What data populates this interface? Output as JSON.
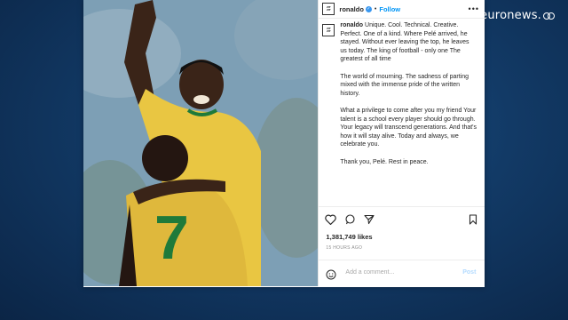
{
  "broadcaster": {
    "logo_text": "euronews."
  },
  "post": {
    "username": "ronaldo",
    "follow_label": "Follow",
    "separator": "•",
    "more_label": "•••",
    "avatar_text": [
      "ZIT",
      "ZIT"
    ],
    "caption_paragraphs": [
      "Unique. Cool. Technical. Creative. Perfect. One of a kind. Where Pelé arrived, he stayed. Without ever leaving the top, he leaves us today. The king of football - only one The greatest of all time",
      "The world of mourning. The sadness of parting mixed with the immense pride of the written history.",
      "What a privilege to come after you my friend Your talent is a school every player should go through. Your legacy will transcend generations. And that's how it will stay alive. Today and always, we celebrate you.",
      "Thank you, Pelé. Rest in peace."
    ],
    "likes": "1,381,749 likes",
    "time_ago": "15 HOURS AGO",
    "comment_placeholder": "Add a comment...",
    "post_button": "Post",
    "jersey_number": "7"
  },
  "colors": {
    "link_blue": "#0095f6",
    "jersey_yellow": "#e9c642",
    "jersey_green": "#1f7a3a"
  }
}
